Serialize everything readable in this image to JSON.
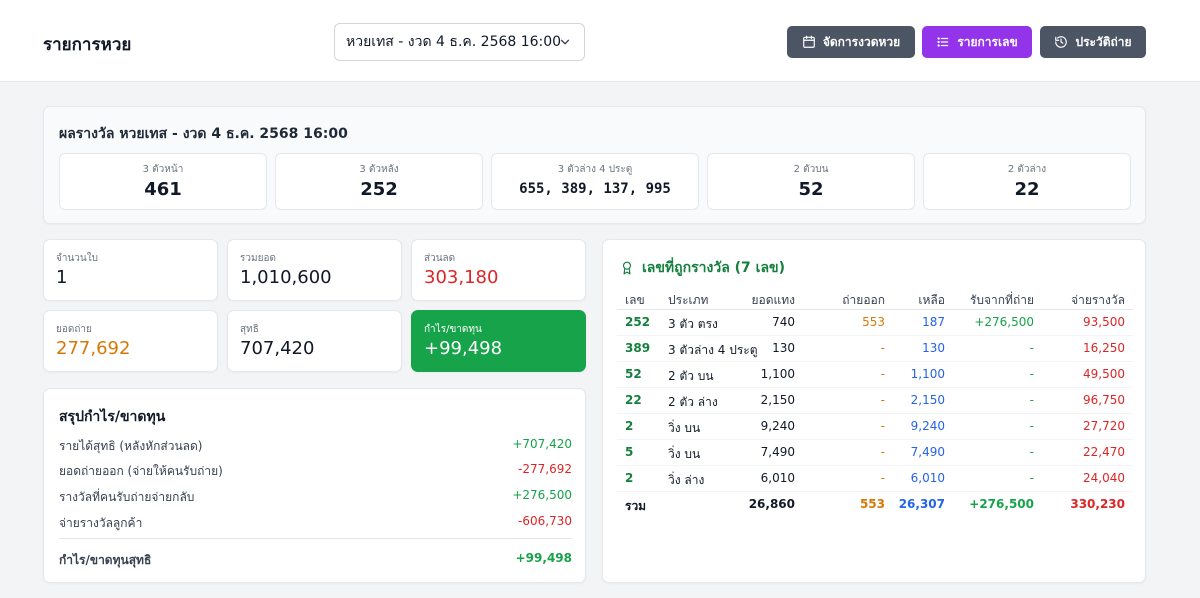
{
  "header": {
    "title": "รายการหวย",
    "draw_select": "หวยเทส - งวด 4 ธ.ค. 2568 16:00",
    "buttons": {
      "manage": "จัดการงวดหวย",
      "list": "รายการเลข",
      "history": "ประวัติถ่าย"
    }
  },
  "results": {
    "title": "ผลรางวัล หวยเทส - งวด 4 ธ.ค. 2568 16:00",
    "items": [
      {
        "label": "3 ตัวหน้า",
        "value": "461"
      },
      {
        "label": "3 ตัวหลัง",
        "value": "252"
      },
      {
        "label": "3 ตัวล่าง 4 ประตู",
        "value": "655, 389, 137, 995"
      },
      {
        "label": "2 ตัวบน",
        "value": "52"
      },
      {
        "label": "2 ตัวล่าง",
        "value": "22"
      }
    ]
  },
  "stats": {
    "tickets": {
      "label": "จำนวนใบ",
      "value": "1"
    },
    "total": {
      "label": "รวมยอด",
      "value": "1,010,600"
    },
    "discount": {
      "label": "ส่วนลด",
      "value": "303,180"
    },
    "transfer": {
      "label": "ยอดถ่าย",
      "value": "277,692"
    },
    "net": {
      "label": "สุทธิ",
      "value": "707,420"
    },
    "profit": {
      "label": "กำไร/ขาดทุน",
      "value": "+99,498"
    }
  },
  "summary": {
    "title": "สรุปกำไร/ขาดทุน",
    "rows": [
      {
        "label": "รายได้สุทธิ (หลังหักส่วนลด)",
        "value": "+707,420"
      },
      {
        "label": "ยอดถ่ายออก (จ่ายให้คนรับถ่าย)",
        "value": "-277,692"
      },
      {
        "label": "รางวัลที่คนรับถ่ายจ่ายกลับ",
        "value": "+276,500"
      },
      {
        "label": "จ่ายรางวัลลูกค้า",
        "value": "-606,730"
      }
    ],
    "net": {
      "label": "กำไร/ขาดทุนสุทธิ",
      "value": "+99,498"
    }
  },
  "winners": {
    "title": "เลขที่ถูกรางวัล (7 เลข)",
    "headers": {
      "number": "เลข",
      "type": "ประเภท",
      "bet": "ยอดแทง",
      "payout": "ถ่ายออก",
      "remain": "เหลือ",
      "received": "รับจากที่ถ่าย",
      "pay": "จ่ายรางวัล"
    },
    "rows": [
      {
        "number": "252",
        "type": "3 ตัว ตรง",
        "bet": "740",
        "payout": "553",
        "remain": "187",
        "received": "+276,500",
        "pay": "93,500"
      },
      {
        "number": "389",
        "type": "3 ตัวล่าง 4 ประตู",
        "bet": "130",
        "payout": "-",
        "remain": "130",
        "received": "-",
        "pay": "16,250"
      },
      {
        "number": "52",
        "type": "2 ตัว บน",
        "bet": "1,100",
        "payout": "-",
        "remain": "1,100",
        "received": "-",
        "pay": "49,500"
      },
      {
        "number": "22",
        "type": "2 ตัว ล่าง",
        "bet": "2,150",
        "payout": "-",
        "remain": "2,150",
        "received": "-",
        "pay": "96,750"
      },
      {
        "number": "2",
        "type": "วิ่ง บน",
        "bet": "9,240",
        "payout": "-",
        "remain": "9,240",
        "received": "-",
        "pay": "27,720"
      },
      {
        "number": "5",
        "type": "วิ่ง บน",
        "bet": "7,490",
        "payout": "-",
        "remain": "7,490",
        "received": "-",
        "pay": "22,470"
      },
      {
        "number": "2",
        "type": "วิ่ง ล่าง",
        "bet": "6,010",
        "payout": "-",
        "remain": "6,010",
        "received": "-",
        "pay": "24,040"
      }
    ],
    "total": {
      "label": "รวม",
      "bet": "26,860",
      "payout": "553",
      "remain": "26,307",
      "received": "+276,500",
      "pay": "330,230"
    }
  },
  "colors": {
    "purple": "#9333ea",
    "gray_button": "#4b5563",
    "green": "#16a34a",
    "red": "#dc2626",
    "orange": "#d97706",
    "blue": "#2563eb"
  }
}
